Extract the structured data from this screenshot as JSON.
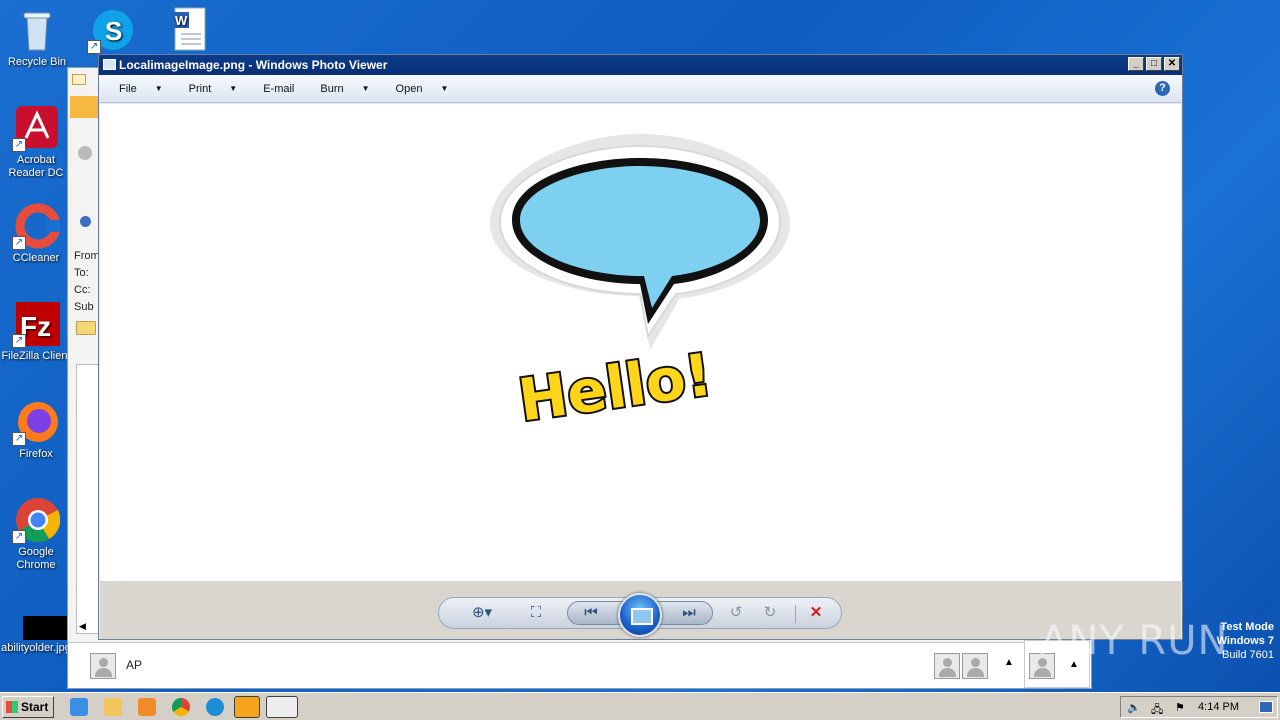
{
  "desktop": {
    "icons": [
      {
        "label": "Recycle Bin"
      },
      {
        "label": "Acrobat Reader DC"
      },
      {
        "label": "CCleaner"
      },
      {
        "label": "FileZilla Client"
      },
      {
        "label": "Firefox"
      },
      {
        "label": "Google Chrome"
      },
      {
        "label": "abilityolder.jpg"
      }
    ],
    "overlay_left_fields": [
      "From",
      "To:",
      "Cc:",
      "Sub"
    ],
    "bottom_contact": "AP",
    "system": {
      "line1": "Test Mode",
      "line2": "Windows 7",
      "line3": "Build 7601"
    },
    "watermark": "ANY RUN"
  },
  "viewer": {
    "title": "LocalimageImage.png - Windows Photo Viewer",
    "menu": [
      {
        "label": "File",
        "has_arrow": true
      },
      {
        "label": "Print",
        "has_arrow": true
      },
      {
        "label": "E-mail",
        "has_arrow": false
      },
      {
        "label": "Burn",
        "has_arrow": true
      },
      {
        "label": "Open",
        "has_arrow": true
      }
    ],
    "image_text": "Hello!",
    "help_glyph": "?"
  },
  "taskbar": {
    "start_label": "Start",
    "clock": "4:14 PM"
  }
}
